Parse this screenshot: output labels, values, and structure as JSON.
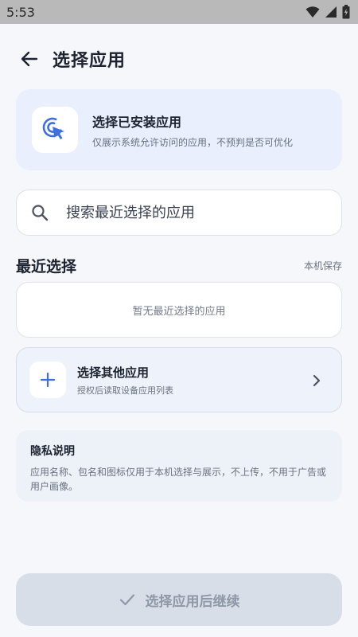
{
  "status_bar": {
    "time": "5:53"
  },
  "header": {
    "title": "选择应用"
  },
  "hero": {
    "title": "选择已安装应用",
    "subtitle": "仅展示系统允许访问的应用，不预判是否可优化"
  },
  "search": {
    "placeholder": "搜索最近选择的应用"
  },
  "recent": {
    "title": "最近选择",
    "note": "本机保存",
    "empty_text": "暂无最近选择的应用"
  },
  "other_app": {
    "title": "选择其他应用",
    "subtitle": "授权后读取设备应用列表"
  },
  "privacy": {
    "title": "隐私说明",
    "body": "应用名称、包名和图标仅用于本机选择与展示，不上传，不用于广告或用户画像。"
  },
  "footer": {
    "continue_label": "选择应用后继续"
  },
  "colors": {
    "accent": "#3d6fe0",
    "disabled": "#8f98a6"
  }
}
